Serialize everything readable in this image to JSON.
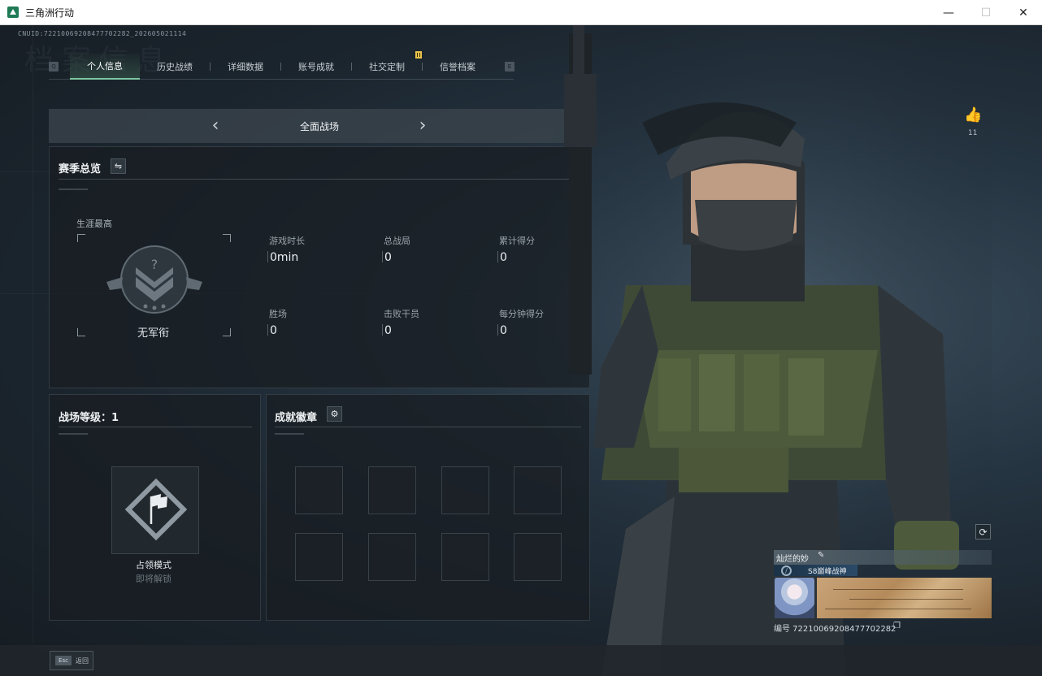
{
  "window": {
    "title": "三角洲行动",
    "minimize": "—",
    "maximize": "☐",
    "close": "✕"
  },
  "uid": "CNUID:72210069208477702282_202605021114",
  "ghost_title": "档案信息",
  "tabs": [
    {
      "label": "个人信息",
      "active": true
    },
    {
      "label": "历史战绩",
      "active": false
    },
    {
      "label": "详细数据",
      "active": false
    },
    {
      "label": "账号成就",
      "active": false
    },
    {
      "label": "社交定制",
      "active": false,
      "badge": true
    },
    {
      "label": "信誉档案",
      "active": false
    }
  ],
  "tab_keys": {
    "left": "Q",
    "right": "E"
  },
  "mode_selector": {
    "label": "全面战场",
    "prev": "‹",
    "next": "›"
  },
  "season": {
    "title": "赛季总览",
    "swap_icon": "swap-icon",
    "career_label": "生涯最高",
    "rank_name": "无军衔",
    "stats": [
      {
        "label": "游戏时长",
        "value": "0min"
      },
      {
        "label": "总战局",
        "value": "0"
      },
      {
        "label": "累计得分",
        "value": "0"
      },
      {
        "label": "胜场",
        "value": "0"
      },
      {
        "label": "击败干员",
        "value": "0"
      },
      {
        "label": "每分钟得分",
        "value": "0"
      }
    ]
  },
  "level": {
    "title": "战场等级：1",
    "mode_name": "占领模式",
    "mode_status": "即将解锁"
  },
  "badges": {
    "title": "成就徽章",
    "settings_icon": "gear-icon",
    "slot_count": 8
  },
  "likes": {
    "count": "11",
    "icon": "thumbs-up-icon"
  },
  "card": {
    "player_name": "灿烂的妙",
    "player_title": "S8巅峰战神",
    "id_line": "编号 72210069208477702282"
  },
  "esc": {
    "key": "Esc",
    "label": "返回"
  },
  "colors": {
    "accent": "#7fc6a2",
    "badge": "#e8c24a"
  }
}
